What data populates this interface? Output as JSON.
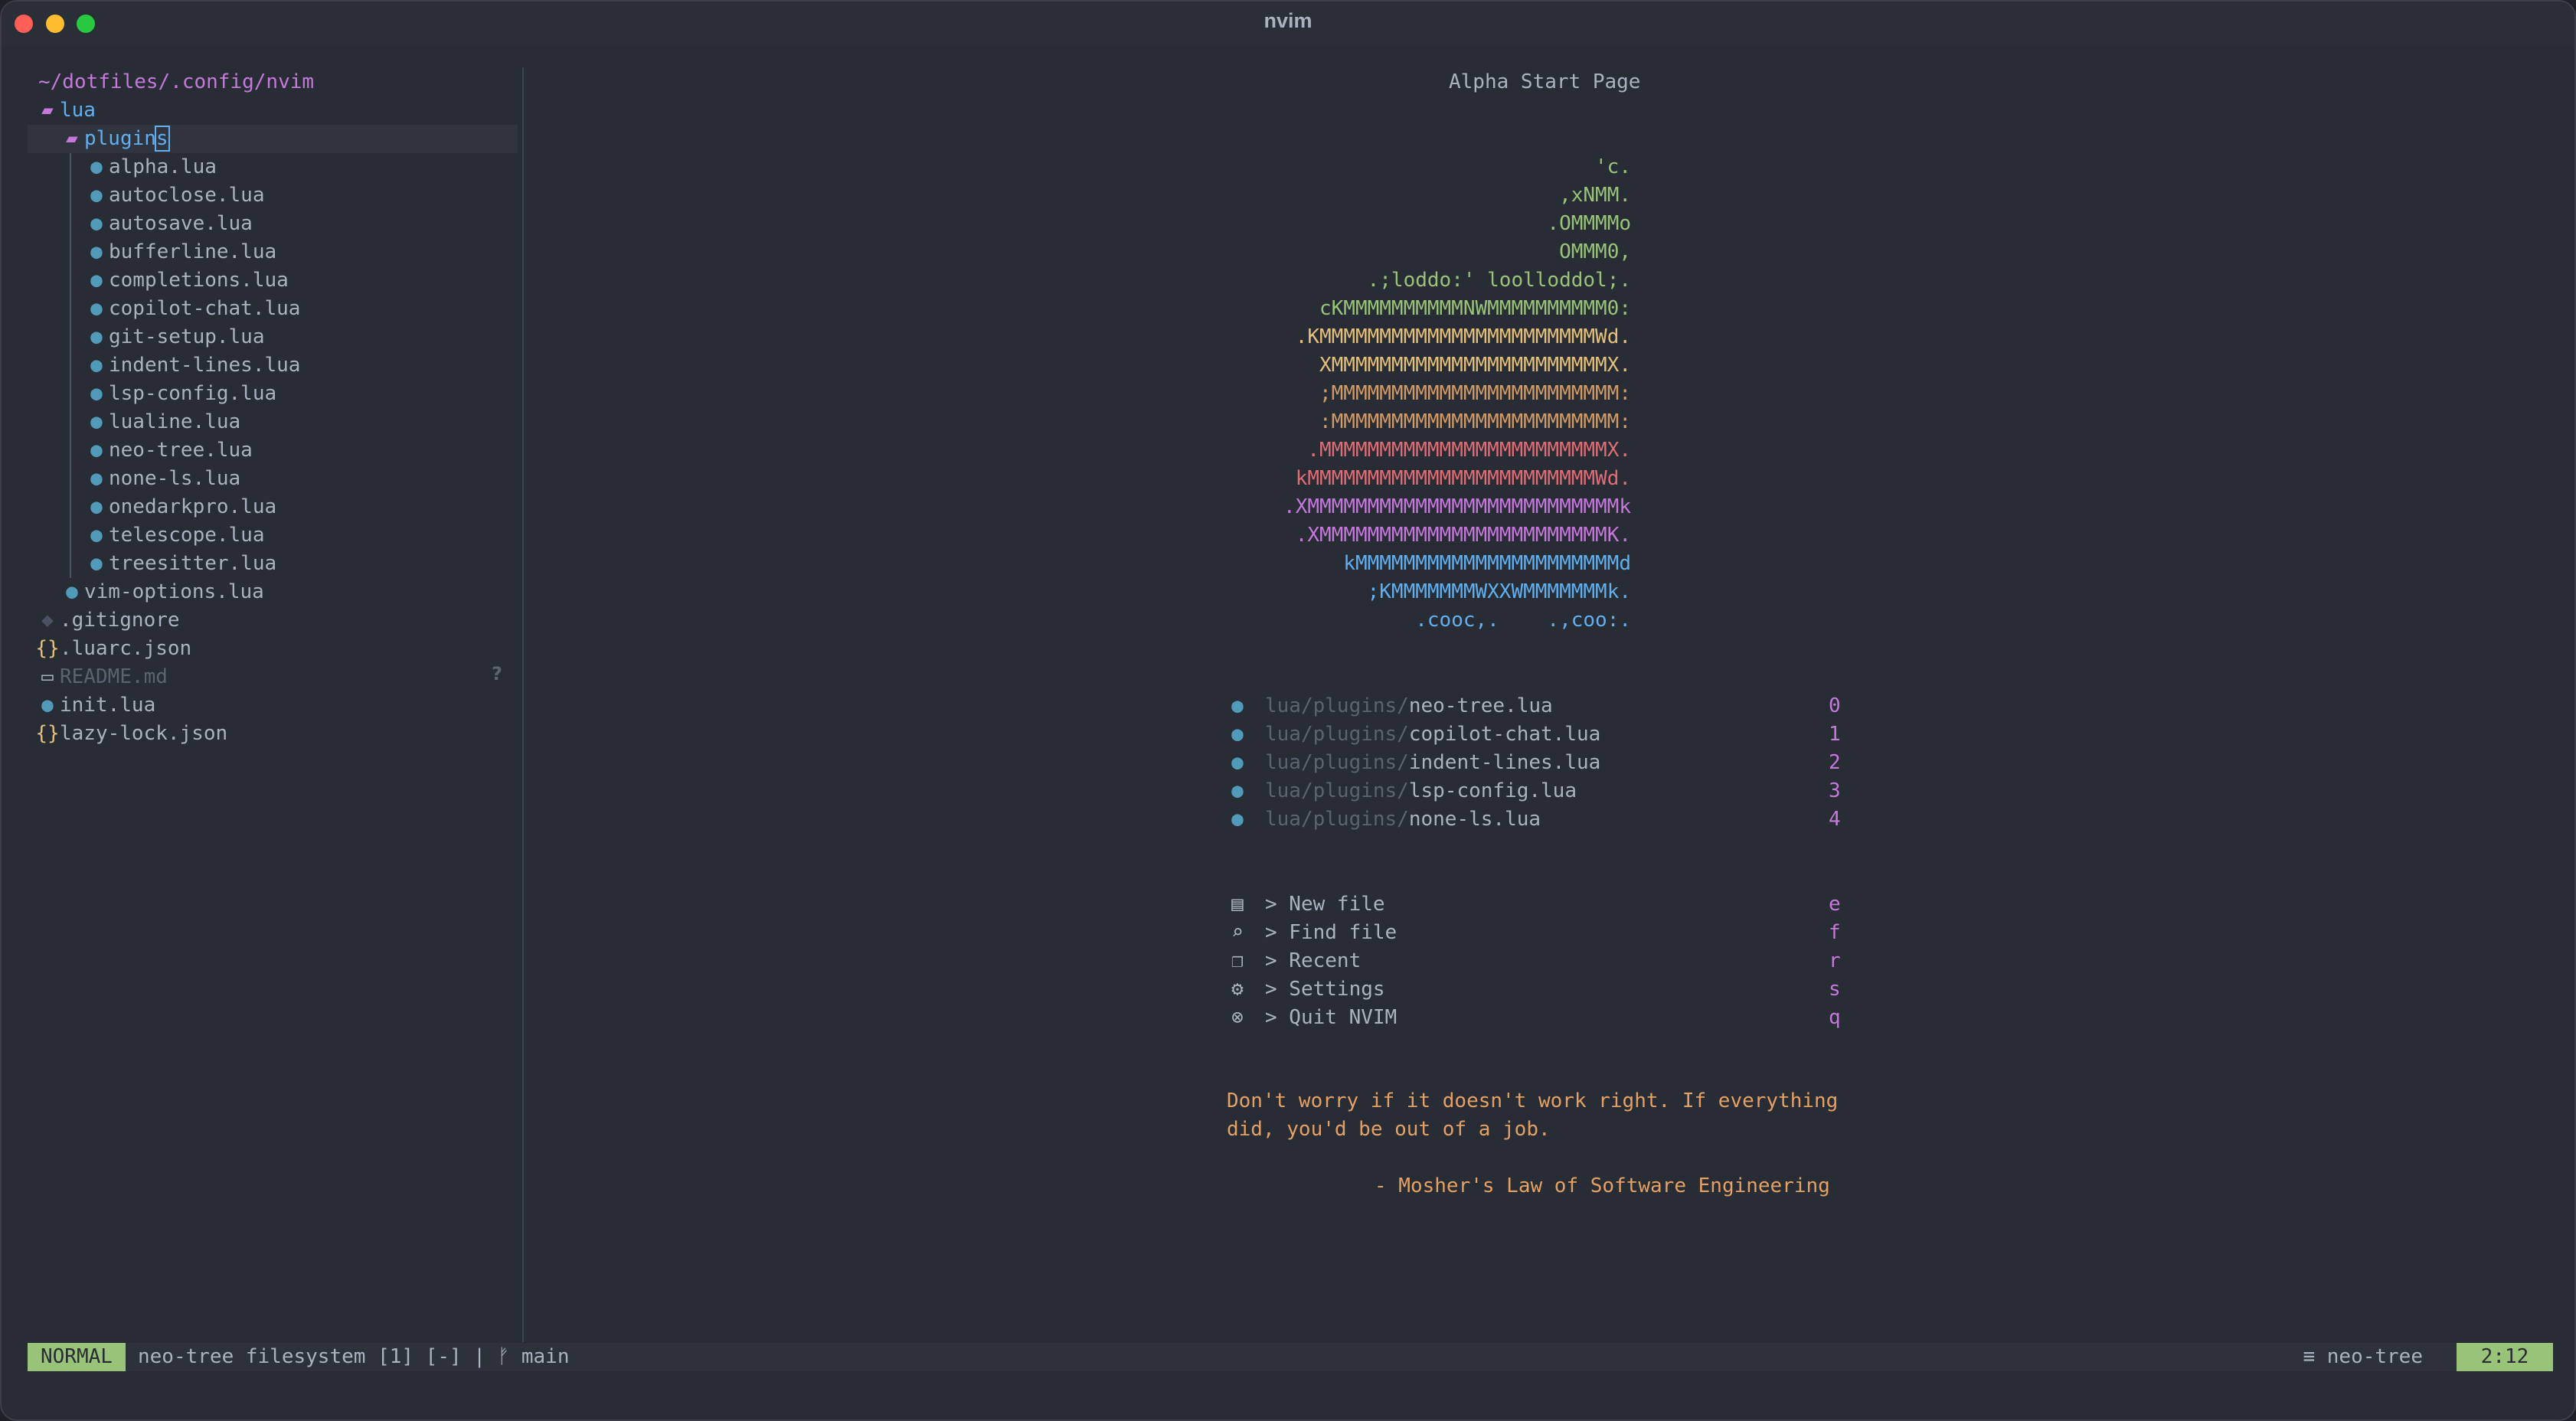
{
  "window": {
    "title": "nvim"
  },
  "tree": {
    "root": "~/dotfiles/.config/nvim",
    "items": [
      {
        "label": "lua",
        "icon": "folder-open-icon",
        "depth": 0,
        "kind": "dir"
      },
      {
        "label": "plugins",
        "icon": "folder-open-icon",
        "depth": 1,
        "kind": "dir"
      },
      {
        "label": "alpha.lua",
        "icon": "lua-file-icon",
        "depth": 2,
        "kind": "file"
      },
      {
        "label": "autoclose.lua",
        "icon": "lua-file-icon",
        "depth": 2,
        "kind": "file"
      },
      {
        "label": "autosave.lua",
        "icon": "lua-file-icon",
        "depth": 2,
        "kind": "file"
      },
      {
        "label": "bufferline.lua",
        "icon": "lua-file-icon",
        "depth": 2,
        "kind": "file"
      },
      {
        "label": "completions.lua",
        "icon": "lua-file-icon",
        "depth": 2,
        "kind": "file"
      },
      {
        "label": "copilot-chat.lua",
        "icon": "lua-file-icon",
        "depth": 2,
        "kind": "file"
      },
      {
        "label": "git-setup.lua",
        "icon": "lua-file-icon",
        "depth": 2,
        "kind": "file"
      },
      {
        "label": "indent-lines.lua",
        "icon": "lua-file-icon",
        "depth": 2,
        "kind": "file"
      },
      {
        "label": "lsp-config.lua",
        "icon": "lua-file-icon",
        "depth": 2,
        "kind": "file"
      },
      {
        "label": "lualine.lua",
        "icon": "lua-file-icon",
        "depth": 2,
        "kind": "file"
      },
      {
        "label": "neo-tree.lua",
        "icon": "lua-file-icon",
        "depth": 2,
        "kind": "file"
      },
      {
        "label": "none-ls.lua",
        "icon": "lua-file-icon",
        "depth": 2,
        "kind": "file"
      },
      {
        "label": "onedarkpro.lua",
        "icon": "lua-file-icon",
        "depth": 2,
        "kind": "file"
      },
      {
        "label": "telescope.lua",
        "icon": "lua-file-icon",
        "depth": 2,
        "kind": "file"
      },
      {
        "label": "treesitter.lua",
        "icon": "lua-file-icon",
        "depth": 2,
        "kind": "file"
      },
      {
        "label": "vim-options.lua",
        "icon": "lua-file-icon",
        "depth": 1,
        "kind": "file"
      },
      {
        "label": ".gitignore",
        "icon": "git-icon",
        "depth": 0,
        "kind": "file"
      },
      {
        "label": ".luarc.json",
        "icon": "json-icon",
        "depth": 0,
        "kind": "file"
      },
      {
        "label": "README.md",
        "icon": "markdown-icon",
        "depth": 0,
        "kind": "ignored",
        "badge": "?"
      },
      {
        "label": "init.lua",
        "icon": "lua-file-icon",
        "depth": 0,
        "kind": "file"
      },
      {
        "label": "lazy-lock.json",
        "icon": "json-icon",
        "depth": 0,
        "kind": "file"
      }
    ]
  },
  "dashboard": {
    "title": "Alpha Start Page",
    "ascii_art": [
      {
        "text": "'c.",
        "color": "#98c379"
      },
      {
        "text": ",xNMM.",
        "color": "#98c379"
      },
      {
        "text": ".OMMMMo",
        "color": "#98c379"
      },
      {
        "text": "OMMM0,",
        "color": "#98c379"
      },
      {
        "text": ".;loddo:' loolloddol;.",
        "color": "#98c379"
      },
      {
        "text": "cKMMMMMMMMMMNWMMMMMMMMMM0:",
        "color": "#98c379"
      },
      {
        "text": ".KMMMMMMMMMMMMMMMMMMMMMMMWd.",
        "color": "#e5c07b"
      },
      {
        "text": "XMMMMMMMMMMMMMMMMMMMMMMMX.",
        "color": "#e5c07b"
      },
      {
        "text": ";MMMMMMMMMMMMMMMMMMMMMMMM:",
        "color": "#d19a66"
      },
      {
        "text": ":MMMMMMMMMMMMMMMMMMMMMMMM:",
        "color": "#d19a66"
      },
      {
        "text": ".MMMMMMMMMMMMMMMMMMMMMMMMX.",
        "color": "#e06c75"
      },
      {
        "text": "kMMMMMMMMMMMMMMMMMMMMMMMMWd.",
        "color": "#e06c75"
      },
      {
        "text": ".XMMMMMMMMMMMMMMMMMMMMMMMMMMk",
        "color": "#c678dd"
      },
      {
        "text": ".XMMMMMMMMMMMMMMMMMMMMMMMMK.",
        "color": "#c678dd"
      },
      {
        "text": "kMMMMMMMMMMMMMMMMMMMMMMd",
        "color": "#61afef"
      },
      {
        "text": ";KMMMMMMMWXXWMMMMMMMk.",
        "color": "#61afef"
      },
      {
        "text": ".cooc,.    .,coo:.",
        "color": "#61afef"
      }
    ],
    "recent_files": [
      {
        "dir": "lua/plugins/",
        "file": "neo-tree.lua",
        "key": "0"
      },
      {
        "dir": "lua/plugins/",
        "file": "copilot-chat.lua",
        "key": "1"
      },
      {
        "dir": "lua/plugins/",
        "file": "indent-lines.lua",
        "key": "2"
      },
      {
        "dir": "lua/plugins/",
        "file": "lsp-config.lua",
        "key": "3"
      },
      {
        "dir": "lua/plugins/",
        "file": "none-ls.lua",
        "key": "4"
      }
    ],
    "actions": [
      {
        "label": "> New file",
        "key": "e",
        "icon": "new-file-icon"
      },
      {
        "label": "> Find file",
        "key": "f",
        "icon": "find-file-icon"
      },
      {
        "label": "> Recent",
        "key": "r",
        "icon": "recent-icon"
      },
      {
        "label": "> Settings",
        "key": "s",
        "icon": "gear-icon"
      },
      {
        "label": "> Quit NVIM",
        "key": "q",
        "icon": "quit-icon"
      }
    ],
    "quote": {
      "line1": "Don't worry if it doesn't work right. If everything",
      "line2": "did, you'd be out of a job.",
      "author": "- Mosher's Law of Software Engineering"
    }
  },
  "statusline": {
    "mode": "NORMAL",
    "left": "neo-tree filesystem [1] [-] | ᚠ main",
    "filetype": "neo-tree",
    "position": "2:12"
  }
}
